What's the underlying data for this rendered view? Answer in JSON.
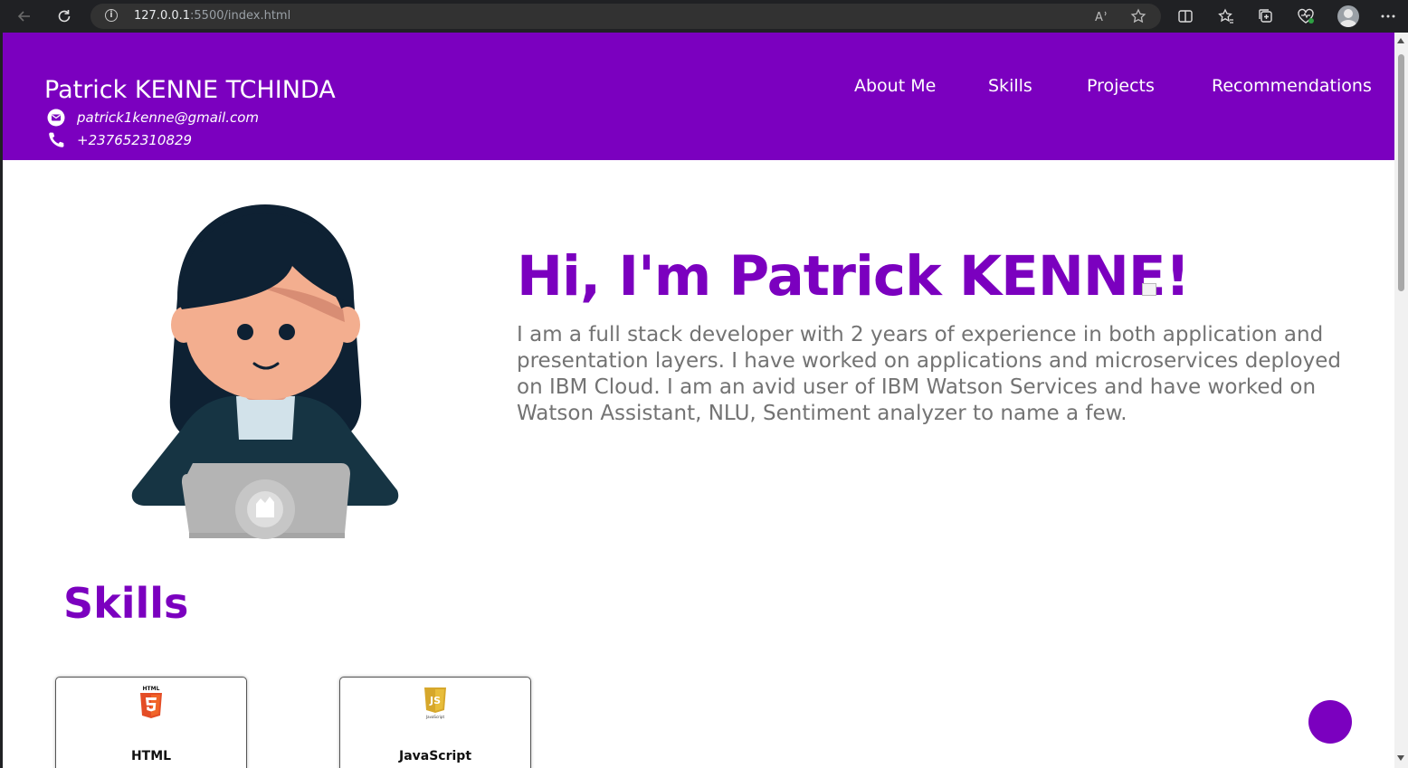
{
  "browser": {
    "url_host": "127.0.0.1",
    "url_rest": ":5500/index.html"
  },
  "header": {
    "name": "Patrick KENNE TCHINDA",
    "email": "patrick1kenne@gmail.com",
    "phone": "+237652310829",
    "nav": [
      "About Me",
      "Skills",
      "Projects",
      "Recommendations"
    ],
    "brand_color": "#7b00bf"
  },
  "hero": {
    "title": "Hi, I'm Patrick KENNE!",
    "text": "I am a full stack developer with 2 years of experience in both application and presentation layers. I have worked on applications and microservices deployed on IBM Cloud. I am an avid user of IBM Watson Services and have worked on Watson Assistant, NLU, Sentiment analyzer to name a few."
  },
  "skills": {
    "title": "Skills",
    "cards": [
      {
        "label": "HTML",
        "icon": "html5-icon",
        "icon_text": "HTML"
      },
      {
        "label": "JavaScript",
        "icon": "javascript-icon",
        "icon_text": "JavaScript"
      }
    ]
  }
}
